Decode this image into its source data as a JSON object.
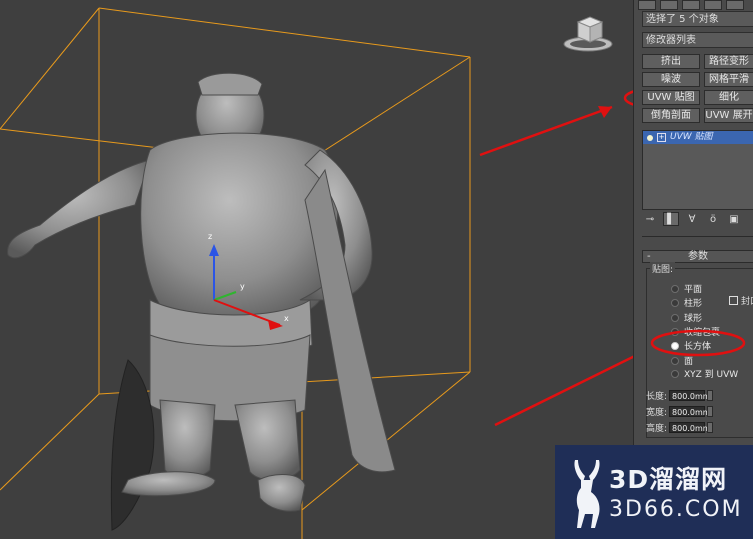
{
  "panel": {
    "selection_field": "选择了 5 个对象",
    "modifier_list": "修改器列表",
    "modifier_buttons": [
      "挤出",
      "路径变形",
      "噪波",
      "网格平滑",
      "UVW 贴图",
      "细化",
      "倒角剖面",
      "UVW 展开"
    ],
    "stack_item": "UVW 贴图",
    "toolbar_icons": [
      "pin-stack-icon",
      "show-end-result-icon",
      "make-unique-icon",
      "remove-modifier-icon",
      "configure-sets-icon"
    ],
    "rollout_title": "参数",
    "mapping_group_label": "贴图:",
    "mapping_options": [
      {
        "label": "平面",
        "selected": false
      },
      {
        "label": "柱形",
        "selected": false
      },
      {
        "label": "球形",
        "selected": false
      },
      {
        "label": "收缩包裹",
        "selected": false
      },
      {
        "label": "长方体",
        "selected": true
      },
      {
        "label": "面",
        "selected": false
      },
      {
        "label": "XYZ 到 UVW",
        "selected": false
      }
    ],
    "cap_checkbox_label": "封口",
    "length_label": "长度:",
    "length_value": "800.0mm",
    "width_label": "宽度:",
    "width_value": "800.0mm",
    "height_label": "高度:",
    "height_value": "800.0mm"
  },
  "viewport": {
    "gizmo_x": "x",
    "gizmo_y": "y",
    "gizmo_z": "z",
    "viewcube_icon": "viewcube-icon"
  },
  "watermark": {
    "title": "3D溜溜网",
    "url": "3D66.COM"
  },
  "colors": {
    "bounding_box": "#e89a1c",
    "annotation_red": "#e01010",
    "stack_highlight": "#3b66b0",
    "watermark_bg": "#1f2e57"
  }
}
